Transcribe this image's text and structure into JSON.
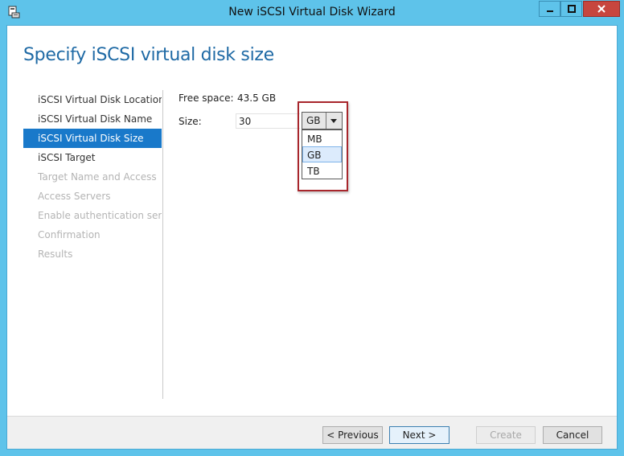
{
  "window": {
    "title": "New iSCSI Virtual Disk Wizard",
    "icon": "wizard-icon",
    "controls": [
      "minimize-icon",
      "maximize-icon",
      "close-icon"
    ]
  },
  "page": {
    "heading": "Specify iSCSI virtual disk size"
  },
  "nav": {
    "items": [
      {
        "label": "iSCSI Virtual Disk Location",
        "state": "done"
      },
      {
        "label": "iSCSI Virtual Disk Name",
        "state": "done"
      },
      {
        "label": "iSCSI Virtual Disk Size",
        "state": "active"
      },
      {
        "label": "iSCSI Target",
        "state": "enabled"
      },
      {
        "label": "Target Name and Access",
        "state": "disabled"
      },
      {
        "label": "Access Servers",
        "state": "disabled"
      },
      {
        "label": "Enable authentication ser...",
        "state": "disabled"
      },
      {
        "label": "Confirmation",
        "state": "disabled"
      },
      {
        "label": "Results",
        "state": "disabled"
      }
    ]
  },
  "form": {
    "free_space_label": "Free space:",
    "free_space_value": "43.5 GB",
    "size_label": "Size:",
    "size_value": "30",
    "unit_selected": "GB",
    "unit_options": [
      "MB",
      "GB",
      "TB"
    ]
  },
  "footer": {
    "previous": "< Previous",
    "next": "Next >",
    "create": "Create",
    "cancel": "Cancel"
  },
  "colors": {
    "titlebar": "#5ec3ea",
    "heading": "#1f6aa5",
    "nav_active": "#1979ca",
    "highlight_border": "#a8262c",
    "close_button": "#c7463e"
  }
}
